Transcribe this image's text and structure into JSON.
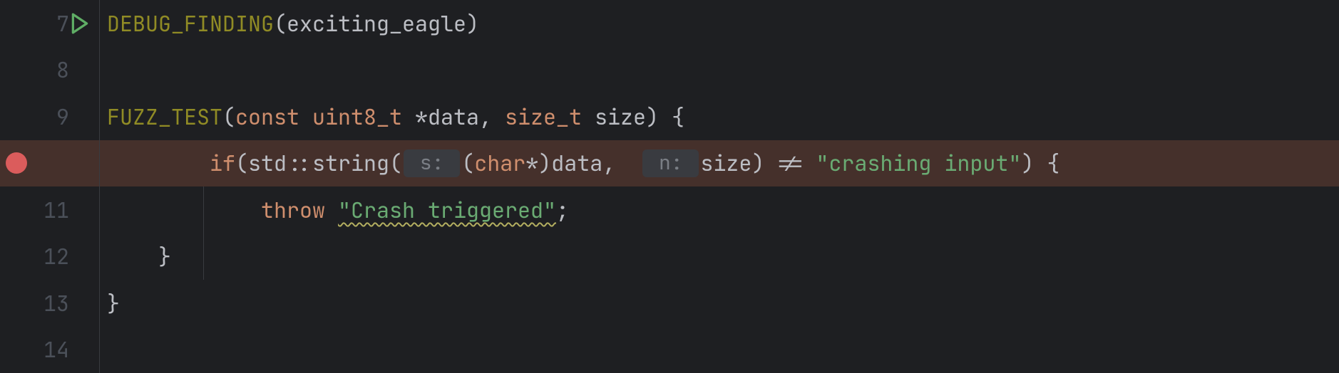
{
  "lines": [
    {
      "num": "7",
      "run_icon": true,
      "breakpoint": false,
      "highlight": false,
      "indent_guide": false,
      "tokens": [
        {
          "cls": "t-macro",
          "text": "DEBUG_FINDING"
        },
        {
          "cls": "t-punc",
          "text": "("
        },
        {
          "cls": "t-ident",
          "text": "exciting_eagle"
        },
        {
          "cls": "t-punc",
          "text": ")"
        }
      ]
    },
    {
      "num": "8",
      "run_icon": false,
      "breakpoint": false,
      "highlight": false,
      "indent_guide": false,
      "tokens": []
    },
    {
      "num": "9",
      "run_icon": false,
      "breakpoint": false,
      "highlight": false,
      "indent_guide": false,
      "tokens": [
        {
          "cls": "t-macro",
          "text": "FUZZ_TEST"
        },
        {
          "cls": "t-punc",
          "text": "("
        },
        {
          "cls": "t-keyword",
          "text": "const"
        },
        {
          "cls": "t-default",
          "text": " "
        },
        {
          "cls": "t-type",
          "text": "uint8_t"
        },
        {
          "cls": "t-default",
          "text": " "
        },
        {
          "cls": "t-op",
          "text": "*"
        },
        {
          "cls": "t-ident",
          "text": "data"
        },
        {
          "cls": "t-punc",
          "text": ","
        },
        {
          "cls": "t-default",
          "text": " "
        },
        {
          "cls": "t-type",
          "text": "size_t"
        },
        {
          "cls": "t-default",
          "text": " "
        },
        {
          "cls": "t-ident",
          "text": "size"
        },
        {
          "cls": "t-punc",
          "text": ")"
        },
        {
          "cls": "t-default",
          "text": " "
        },
        {
          "cls": "t-punc",
          "text": "{"
        }
      ]
    },
    {
      "num": "",
      "run_icon": false,
      "breakpoint": true,
      "highlight": true,
      "indent_guide": false,
      "tokens": [
        {
          "cls": "t-default",
          "text": "        "
        },
        {
          "cls": "t-keyword",
          "text": "if"
        },
        {
          "cls": "t-punc",
          "text": "("
        },
        {
          "cls": "t-ident",
          "text": "std"
        },
        {
          "cls": "t-op",
          "text": "::"
        },
        {
          "cls": "t-ident",
          "text": "string"
        },
        {
          "cls": "t-punc",
          "text": "("
        },
        {
          "cls": "hint-chip",
          "text": " s: ",
          "hint": true
        },
        {
          "cls": "t-punc",
          "text": "("
        },
        {
          "cls": "t-keyword",
          "text": "char"
        },
        {
          "cls": "t-op",
          "text": "*"
        },
        {
          "cls": "t-punc",
          "text": ")"
        },
        {
          "cls": "t-ident",
          "text": "data"
        },
        {
          "cls": "t-punc",
          "text": ","
        },
        {
          "cls": "t-default",
          "text": "  "
        },
        {
          "cls": "hint-chip",
          "text": " n: ",
          "hint": true
        },
        {
          "cls": "t-ident",
          "text": "size"
        },
        {
          "cls": "t-punc",
          "text": ")"
        },
        {
          "cls": "t-default",
          "text": " "
        },
        {
          "cls": "t-op",
          "text": "!="
        },
        {
          "cls": "t-default",
          "text": " "
        },
        {
          "cls": "t-string",
          "text": "\"crashing input\""
        },
        {
          "cls": "t-punc",
          "text": ")"
        },
        {
          "cls": "t-default",
          "text": " "
        },
        {
          "cls": "t-punc",
          "text": "{"
        }
      ]
    },
    {
      "num": "11",
      "run_icon": false,
      "breakpoint": false,
      "highlight": false,
      "indent_guide": true,
      "tokens": [
        {
          "cls": "t-default",
          "text": "            "
        },
        {
          "cls": "t-keyword",
          "text": "throw"
        },
        {
          "cls": "t-default",
          "text": " "
        },
        {
          "cls": "t-string",
          "text": "\"Crash triggered\"",
          "wavy": true
        },
        {
          "cls": "t-punc",
          "text": ";"
        }
      ]
    },
    {
      "num": "12",
      "run_icon": false,
      "breakpoint": false,
      "highlight": false,
      "indent_guide": true,
      "tokens": [
        {
          "cls": "t-default",
          "text": "    "
        },
        {
          "cls": "t-punc",
          "text": "}"
        }
      ]
    },
    {
      "num": "13",
      "run_icon": false,
      "breakpoint": false,
      "highlight": false,
      "indent_guide": false,
      "tokens": [
        {
          "cls": "t-punc",
          "text": "}"
        }
      ]
    },
    {
      "num": "14",
      "run_icon": false,
      "breakpoint": false,
      "highlight": false,
      "indent_guide": false,
      "tokens": []
    }
  ],
  "icons": {
    "run_color": "#5fad65"
  }
}
